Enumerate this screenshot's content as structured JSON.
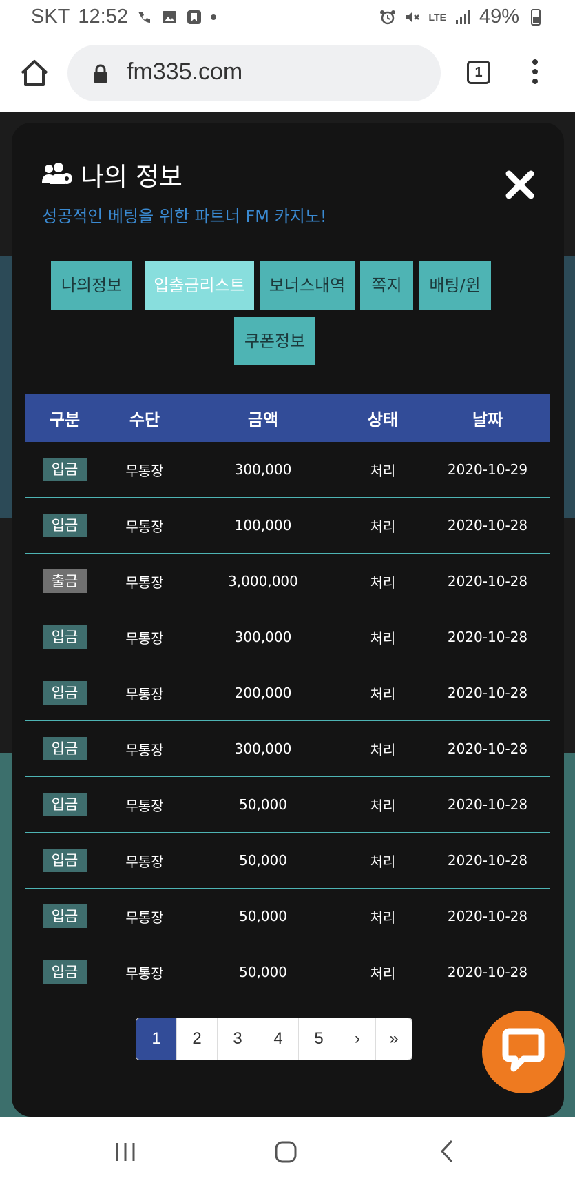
{
  "status_bar": {
    "carrier": "SKT",
    "time": "12:52",
    "network": "LTE",
    "battery": "49%"
  },
  "browser": {
    "url": "fm335.com",
    "tab_count": "1"
  },
  "modal": {
    "title": "나의 정보",
    "subtitle": "성공적인 베팅을 위한 파트너 FM 카지노!",
    "tabs": [
      "나의정보",
      "입출금리스트",
      "보너스내역",
      "쪽지",
      "배팅/윈",
      "쿠폰정보"
    ],
    "active_tab": "입출금리스트",
    "table": {
      "headers": [
        "구분",
        "수단",
        "금액",
        "상태",
        "날짜"
      ],
      "rows": [
        {
          "type": "입금",
          "method": "무통장",
          "amount": "300,000",
          "status": "처리",
          "date": "2020-10-29"
        },
        {
          "type": "입금",
          "method": "무통장",
          "amount": "100,000",
          "status": "처리",
          "date": "2020-10-28"
        },
        {
          "type": "출금",
          "method": "무통장",
          "amount": "3,000,000",
          "status": "처리",
          "date": "2020-10-28"
        },
        {
          "type": "입금",
          "method": "무통장",
          "amount": "300,000",
          "status": "처리",
          "date": "2020-10-28"
        },
        {
          "type": "입금",
          "method": "무통장",
          "amount": "200,000",
          "status": "처리",
          "date": "2020-10-28"
        },
        {
          "type": "입금",
          "method": "무통장",
          "amount": "300,000",
          "status": "처리",
          "date": "2020-10-28"
        },
        {
          "type": "입금",
          "method": "무통장",
          "amount": "50,000",
          "status": "처리",
          "date": "2020-10-28"
        },
        {
          "type": "입금",
          "method": "무통장",
          "amount": "50,000",
          "status": "처리",
          "date": "2020-10-28"
        },
        {
          "type": "입금",
          "method": "무통장",
          "amount": "50,000",
          "status": "처리",
          "date": "2020-10-28"
        },
        {
          "type": "입금",
          "method": "무통장",
          "amount": "50,000",
          "status": "처리",
          "date": "2020-10-28"
        }
      ]
    },
    "pagination": {
      "pages": [
        "1",
        "2",
        "3",
        "4",
        "5"
      ],
      "next": "›",
      "last": "»",
      "current": "1"
    }
  },
  "colors": {
    "header_blue": "#324c98",
    "tab_teal": "#4eb4b4",
    "tab_active": "#88dedd",
    "deposit_badge": "#3f6e6e",
    "withdraw_badge": "#707070",
    "subtitle_blue": "#3a8ad2",
    "chat_orange": "#ee7a20"
  },
  "icons": {
    "title": "users-gear-icon",
    "close": "close-icon",
    "chat": "chat-icon"
  }
}
